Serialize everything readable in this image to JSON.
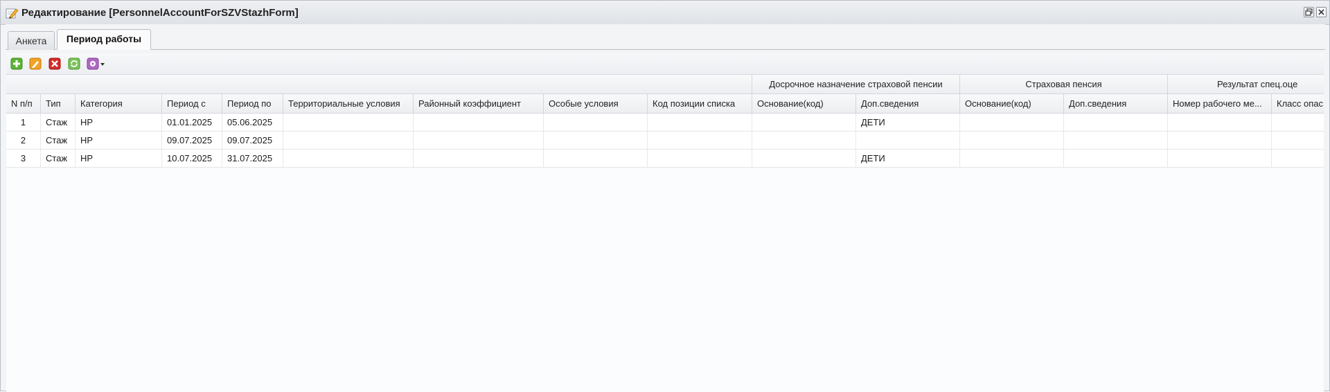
{
  "window": {
    "title": "Редактирование [PersonnelAccountForSZVStazhForm]",
    "icon": "edit-form-icon",
    "buttons": [
      "restore-icon",
      "close-icon"
    ]
  },
  "tabs": [
    {
      "label": "Анкета",
      "active": false
    },
    {
      "label": "Период работы",
      "active": true
    }
  ],
  "toolbar": {
    "buttons": [
      "add-icon",
      "edit-icon",
      "delete-icon",
      "refresh-icon",
      "settings-dropdown-icon"
    ],
    "colors": {
      "add": "#5bb336",
      "edit": "#f0a324",
      "delete": "#d52a2a",
      "refresh": "#7cc35a",
      "settings": "#b067c4"
    }
  },
  "grid": {
    "group_headers": {
      "early_pension": "Досрочное назначение страховой пенсии",
      "insurance_pension": "Страховая пенсия",
      "special_assessment": "Результат спец.оце"
    },
    "columns": [
      "N п/п",
      "Тип",
      "Категория",
      "Период с",
      "Период по",
      "Территориальные условия",
      "Районный коэффициент",
      "Особые условия",
      "Код позиции списка",
      "Основание(код)",
      "Доп.сведения",
      "Основание(код)",
      "Доп.сведения",
      "Номер рабочего ме...",
      "Класс опас"
    ],
    "rows": [
      {
        "n": "1",
        "type": "Стаж",
        "category": "НР",
        "from": "01.01.2025",
        "to": "05.06.2025",
        "territorial": "",
        "district_coef": "",
        "special": "",
        "list_code": "",
        "early_basis": "",
        "early_extra": "ДЕТИ",
        "ins_basis": "",
        "ins_extra": "",
        "workplace_no": "",
        "hazard_class": ""
      },
      {
        "n": "2",
        "type": "Стаж",
        "category": "НР",
        "from": "09.07.2025",
        "to": "09.07.2025",
        "territorial": "",
        "district_coef": "",
        "special": "",
        "list_code": "",
        "early_basis": "",
        "early_extra": "",
        "ins_basis": "",
        "ins_extra": "",
        "workplace_no": "",
        "hazard_class": ""
      },
      {
        "n": "3",
        "type": "Стаж",
        "category": "НР",
        "from": "10.07.2025",
        "to": "31.07.2025",
        "territorial": "",
        "district_coef": "",
        "special": "",
        "list_code": "",
        "early_basis": "",
        "early_extra": "ДЕТИ",
        "ins_basis": "",
        "ins_extra": "",
        "workplace_no": "",
        "hazard_class": ""
      }
    ]
  }
}
